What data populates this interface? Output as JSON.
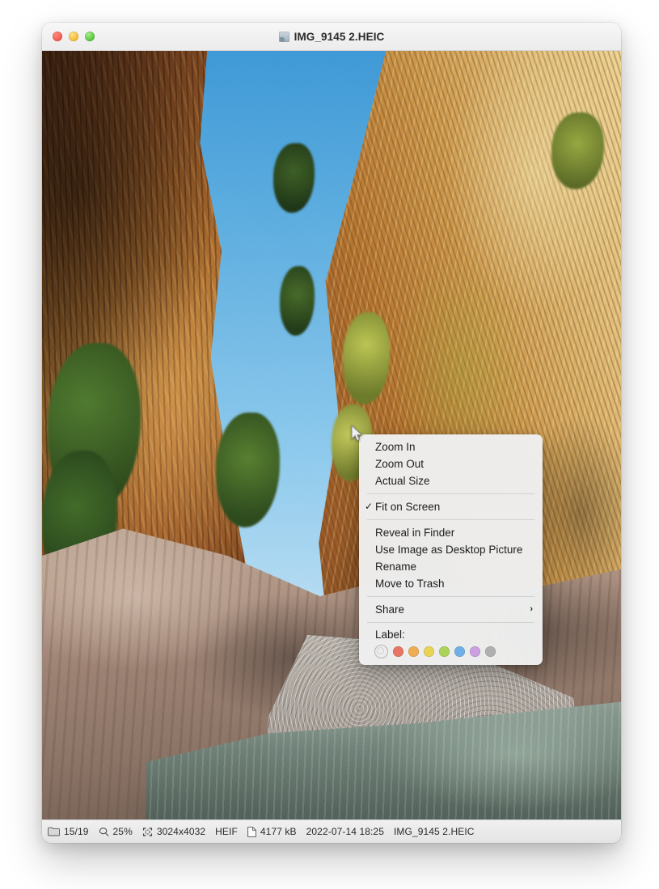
{
  "window": {
    "title": "IMG_9145 2.HEIC",
    "title_icon": "image-file-icon",
    "traffic_lights": [
      {
        "name": "close-button",
        "color": "#f3564b"
      },
      {
        "name": "minimize-button",
        "color": "#f3b82e"
      },
      {
        "name": "maximize-button",
        "color": "#52c13a"
      }
    ]
  },
  "photo": {
    "description": "Narrow rocky canyon gorge with sunlit golden cliff on the right, shaded orange-brown cliff on the left, blue sky above, boulders and a shallow stream below",
    "colors": {
      "sky_top": "#3e9ad8",
      "sky_bottom": "#dff0fb",
      "cliff_left": "#b06a2c",
      "cliff_right": "#e2bc75",
      "boulders": "#b89d8c",
      "water": "#6e8278",
      "vegetation": "#4f7a2e"
    }
  },
  "context_menu": {
    "sections": [
      {
        "items": [
          {
            "label": "Zoom In",
            "checked": false,
            "submenu": false
          },
          {
            "label": "Zoom Out",
            "checked": false,
            "submenu": false
          },
          {
            "label": "Actual Size",
            "checked": false,
            "submenu": false
          }
        ]
      },
      {
        "items": [
          {
            "label": "Fit on Screen",
            "checked": true,
            "submenu": false
          }
        ]
      },
      {
        "items": [
          {
            "label": "Reveal in Finder",
            "checked": false,
            "submenu": false
          },
          {
            "label": "Use Image as Desktop Picture",
            "checked": false,
            "submenu": false
          },
          {
            "label": "Rename",
            "checked": false,
            "submenu": false
          },
          {
            "label": "Move to Trash",
            "checked": false,
            "submenu": false
          }
        ]
      },
      {
        "items": [
          {
            "label": "Share",
            "checked": false,
            "submenu": true,
            "submenu_glyph": "›"
          }
        ]
      }
    ],
    "checkmark_glyph": "✓",
    "label_section": {
      "title": "Label:",
      "swatches": [
        {
          "name": "label-none",
          "color": "none"
        },
        {
          "name": "label-red",
          "color": "#e87561"
        },
        {
          "name": "label-orange",
          "color": "#eeac55"
        },
        {
          "name": "label-yellow",
          "color": "#e9d457"
        },
        {
          "name": "label-green",
          "color": "#acd359"
        },
        {
          "name": "label-blue",
          "color": "#6fb0e8"
        },
        {
          "name": "label-purple",
          "color": "#ccA0e0"
        },
        {
          "name": "label-gray",
          "color": "#b0b0b0"
        }
      ]
    }
  },
  "status_bar": {
    "items": [
      {
        "icon": "folder-icon",
        "text": "15/19"
      },
      {
        "icon": "magnifier-icon",
        "text": "25%"
      },
      {
        "icon": "crop-marks-icon",
        "text": "3024x4032"
      },
      {
        "icon": "",
        "text": "HEIF"
      },
      {
        "icon": "document-icon",
        "text": "4177 kB"
      },
      {
        "icon": "",
        "text": "2022-07-14 18:25"
      },
      {
        "icon": "",
        "text": "IMG_9145 2.HEIC"
      }
    ]
  }
}
